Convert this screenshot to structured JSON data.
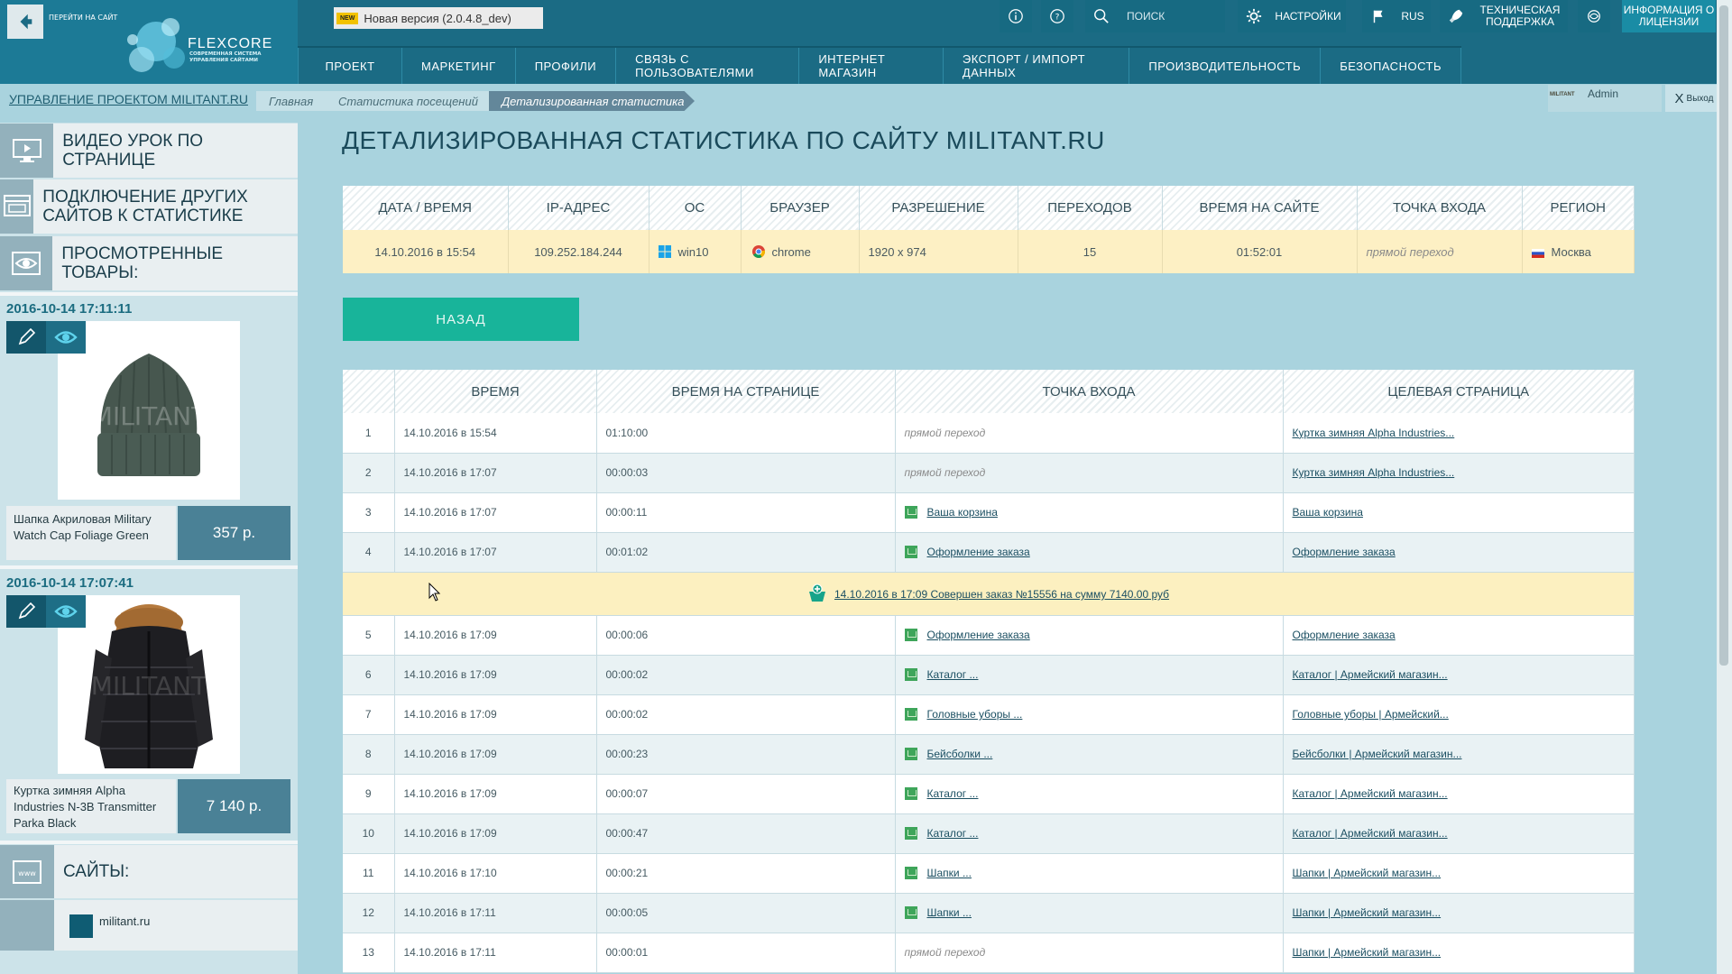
{
  "topbar": {
    "goto_site": "ПЕРЕЙТИ НА САЙТ",
    "logo_name": "FLEXCORE",
    "logo_tagline": "СОВРЕМЕННАЯ СИСТЕМА УПРАВЛЕНИЯ САЙТАМИ",
    "new_badge": "NEW",
    "version": "Новая версия (2.0.4.8_dev)",
    "search_placeholder": "ПОИСК",
    "settings": "НАСТРОЙКИ",
    "lang": "RUS",
    "support": "ТЕХНИЧЕСКАЯ ПОДДЕРЖКА",
    "license": "ИНФОРМАЦИЯ О ЛИЦЕНЗИИ"
  },
  "menu": [
    "ПРОЕКТ",
    "МАРКЕТИНГ",
    "ПРОФИЛИ",
    "СВЯЗЬ С ПОЛЬЗОВАТЕЛЯМИ",
    "ИНТЕРНЕТ МАГАЗИН",
    "ЭКСПОРТ / ИМПОРТ ДАННЫХ",
    "ПРОИЗВОДИТЕЛЬНОСТЬ",
    "БЕЗОПАСНОСТЬ"
  ],
  "breadcrumb": {
    "project": "УПРАВЛЕНИЕ ПРОЕКТОМ MILITANT.RU",
    "items": [
      "Главная",
      "Статистика посещений",
      "Детализированная статистика"
    ]
  },
  "user": {
    "name": "Admin",
    "logo_text": "MILITANT",
    "exit": "Выход"
  },
  "sidebar": {
    "video": "ВИДЕО УРОК ПО СТРАНИЦЕ",
    "connect": "ПОДКЛЮЧЕНИЕ ДРУГИХ САЙТОВ К СТАТИСТИКЕ",
    "viewed": "ПРОСМОТРЕННЫЕ ТОВАРЫ:",
    "products": [
      {
        "date": "2016-10-14 17:11:11",
        "name": "Шапка Акриловая Military Watch Cap Foliage Green",
        "price": "357 р."
      },
      {
        "date": "2016-10-14 17:07:41",
        "name": "Куртка зимняя Alpha Industries N-3B Transmitter Parka Black",
        "price": "7 140 р."
      }
    ],
    "sites_label": "САЙТЫ:",
    "site": "militant.ru",
    "watermark": "MILITANT"
  },
  "page_title": "ДЕТАЛИЗИРОВАННАЯ СТАТИСТИКА ПО САЙТУ MILITANT.RU",
  "summary": {
    "headers": [
      "ДАТА / ВРЕМЯ",
      "IP-АДРЕС",
      "ОС",
      "БРАУЗЕР",
      "РАЗРЕШЕНИЕ",
      "ПЕРЕХОДОВ",
      "ВРЕМЯ НА САЙТЕ",
      "ТОЧКА ВХОДА",
      "РЕГИОН"
    ],
    "row": {
      "datetime": "14.10.2016 в 15:54",
      "ip": "109.252.184.244",
      "os": "win10",
      "browser": "chrome",
      "resolution": "1920 x 974",
      "visits": "15",
      "time": "01:52:01",
      "entry": "прямой переход",
      "region": "Москва"
    }
  },
  "back_button": "НАЗАД",
  "visits": {
    "headers": [
      "",
      "ВРЕМЯ",
      "ВРЕМЯ НА СТРАНИЦЕ",
      "ТОЧКА ВХОДА",
      "ЦЕЛЕВАЯ СТРАНИЦА"
    ],
    "rows": [
      {
        "n": "1",
        "time": "14.10.2016 в 15:54",
        "dur": "01:10:00",
        "entry": "прямой переход",
        "direct": true,
        "target": "Куртка зимняя Alpha Industries..."
      },
      {
        "n": "2",
        "time": "14.10.2016 в 17:07",
        "dur": "00:00:03",
        "entry": "прямой переход",
        "direct": true,
        "target": "Куртка зимняя Alpha Industries..."
      },
      {
        "n": "3",
        "time": "14.10.2016 в 17:07",
        "dur": "00:00:11",
        "entry": "Ваша корзина",
        "direct": false,
        "target": "Ваша корзина"
      },
      {
        "n": "4",
        "time": "14.10.2016 в 17:07",
        "dur": "00:01:02",
        "entry": "Оформление заказа",
        "direct": false,
        "target": "Оформление заказа"
      },
      {
        "n": "5",
        "time": "14.10.2016 в 17:09",
        "dur": "00:00:06",
        "entry": "Оформление заказа",
        "direct": false,
        "target": "Оформление заказа"
      },
      {
        "n": "6",
        "time": "14.10.2016 в 17:09",
        "dur": "00:00:02",
        "entry": "Каталог ...",
        "direct": false,
        "target": "Каталог | Армейский магазин..."
      },
      {
        "n": "7",
        "time": "14.10.2016 в 17:09",
        "dur": "00:00:02",
        "entry": "Головные уборы ...",
        "direct": false,
        "target": "Головные уборы | Армейский..."
      },
      {
        "n": "8",
        "time": "14.10.2016 в 17:09",
        "dur": "00:00:23",
        "entry": "Бейсболки ...",
        "direct": false,
        "target": "Бейсболки | Армейский магазин..."
      },
      {
        "n": "9",
        "time": "14.10.2016 в 17:09",
        "dur": "00:00:07",
        "entry": "Каталог ...",
        "direct": false,
        "target": "Каталог | Армейский магазин..."
      },
      {
        "n": "10",
        "time": "14.10.2016 в 17:09",
        "dur": "00:00:47",
        "entry": "Каталог ...",
        "direct": false,
        "target": "Каталог | Армейский магазин..."
      },
      {
        "n": "11",
        "time": "14.10.2016 в 17:10",
        "dur": "00:00:21",
        "entry": "Шапки ...",
        "direct": false,
        "target": "Шапки | Армейский магазин..."
      },
      {
        "n": "12",
        "time": "14.10.2016 в 17:11",
        "dur": "00:00:05",
        "entry": "Шапки ...",
        "direct": false,
        "target": "Шапки | Армейский магазин..."
      },
      {
        "n": "13",
        "time": "14.10.2016 в 17:11",
        "dur": "00:00:01",
        "entry": "прямой переход",
        "direct": true,
        "target": "Шапки | Армейский магазин..."
      }
    ],
    "order_after": 4,
    "order_text": "14.10.2016 в 17:09 Совершен заказ №15556 на сумму 7140.00 руб"
  },
  "colors": {
    "topbar": "#1b6b84",
    "background": "#a9d3de",
    "accent_button": "#18b49a",
    "highlight_row": "#fdf0c4"
  }
}
